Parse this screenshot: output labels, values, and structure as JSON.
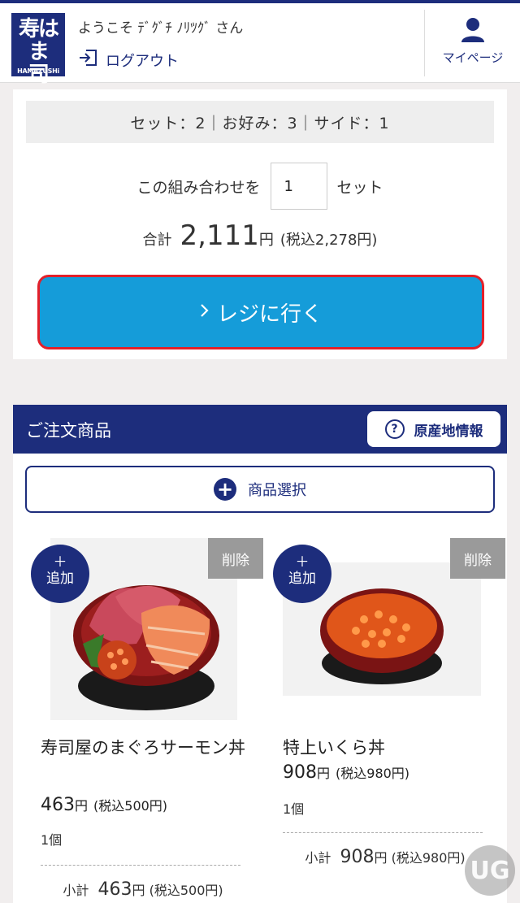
{
  "header": {
    "logo_kanji_top": "寿はま",
    "logo_kanji_bottom": "司",
    "logo_roman": "HAMAZUSHi",
    "welcome": "ようこそ ﾃﾞｸﾞﾁ ﾉﾘﾂｸﾞ さん",
    "logout_label": "ログアウト",
    "mypage_label": "マイページ"
  },
  "cart": {
    "summary": "セット：2｜お好み：3｜サイド：1",
    "combo_label": "この組み合わせを",
    "quantity": "1",
    "set_label": "セット",
    "total_label": "合計",
    "total_amount": "2,111",
    "yen": "円",
    "total_tax": "(税込2,278円)",
    "register_label": "レジに行く"
  },
  "order": {
    "title": "ご注文商品",
    "origin_label": "原産地情報",
    "select_label": "商品選択",
    "add_label_1": "＋",
    "add_label_2": "追加",
    "delete_label": "削除",
    "subtotal_label": "小計",
    "items": [
      {
        "name": "寿司屋のまぐろサーモン丼",
        "price": "463",
        "tax": "(税込500円)",
        "count": "1個",
        "subtotal": "463",
        "subtotal_tax": "(税込500円)"
      },
      {
        "name": "特上いくら丼",
        "price": "908",
        "tax": "(税込980円)",
        "count": "1個",
        "subtotal": "908",
        "subtotal_tax": "(税込980円)"
      }
    ]
  },
  "colors": {
    "brand": "#1d2d7c",
    "register": "#159cd9",
    "highlight": "#e3202a"
  }
}
